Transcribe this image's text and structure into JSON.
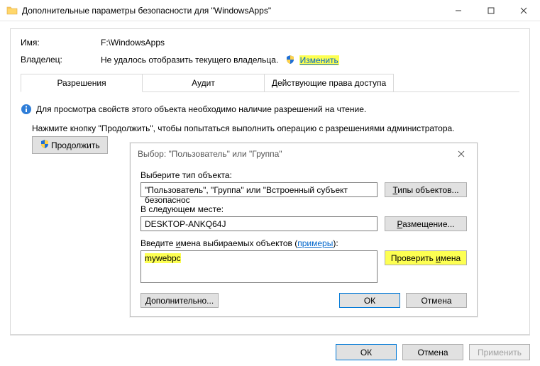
{
  "window": {
    "title": "Дополнительные параметры безопасности  для \"WindowsApps\""
  },
  "fields": {
    "name_label": "Имя:",
    "name_value": "F:\\WindowsApps",
    "owner_label": "Владелец:",
    "owner_text": "Не удалось отобразить текущего владельца.",
    "change_link": "Изменить"
  },
  "tabs": {
    "permissions": "Разрешения",
    "audit": "Аудит",
    "effective": "Действующие права доступа"
  },
  "info_text": "Для просмотра свойств этого объекта необходимо наличие разрешений на чтение.",
  "continue_hint": "Нажмите кнопку \"Продолжить\", чтобы попытаться выполнить операцию с разрешениями администратора.",
  "continue_btn": "Продолжить",
  "dialog": {
    "title": "Выбор: \"Пользователь\" или \"Группа\"",
    "obj_type_label": "Выберите тип объекта:",
    "obj_type_value": "\"Пользователь\", \"Группа\" или \"Встроенный субъект безопаснос",
    "obj_types_btn": "Типы объектов...",
    "loc_label": "В следующем месте:",
    "loc_value": "DESKTOP-ANKQ64J",
    "loc_btn": "Размещение...",
    "names_label_pre": "Введите ",
    "names_label_u": "и",
    "names_label_post": "мена выбираемых объектов (",
    "examples_link": "примеры",
    "names_label_end": "):",
    "names_value": "mywebpc",
    "check_btn": "Проверить имена",
    "adv_btn_pre": "Д",
    "adv_btn_post": "ополнительно...",
    "ok": "ОК",
    "cancel": "Отмена"
  },
  "main_buttons": {
    "ok": "ОК",
    "cancel": "Отмена",
    "apply": "Применить"
  }
}
